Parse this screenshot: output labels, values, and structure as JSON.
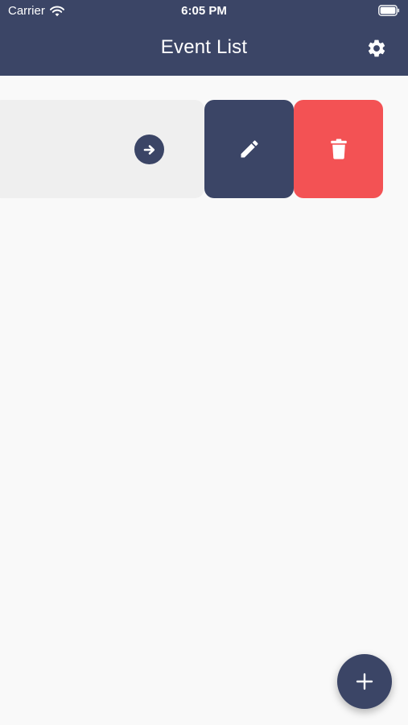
{
  "status_bar": {
    "carrier": "Carrier",
    "time": "6:05 PM",
    "icons": [
      "wifi-icon",
      "battery-icon"
    ]
  },
  "app_bar": {
    "title": "Event List",
    "settings_icon": "gear-icon"
  },
  "event_item": {
    "open_icon": "arrow-right-icon",
    "actions": [
      {
        "name": "edit",
        "icon": "pencil-icon"
      },
      {
        "name": "delete",
        "icon": "trash-icon"
      }
    ]
  },
  "fab": {
    "icon": "plus-icon"
  },
  "colors": {
    "primary": "#3b4566",
    "danger": "#f35254",
    "card": "#efefef",
    "background": "#f9f9f9"
  }
}
